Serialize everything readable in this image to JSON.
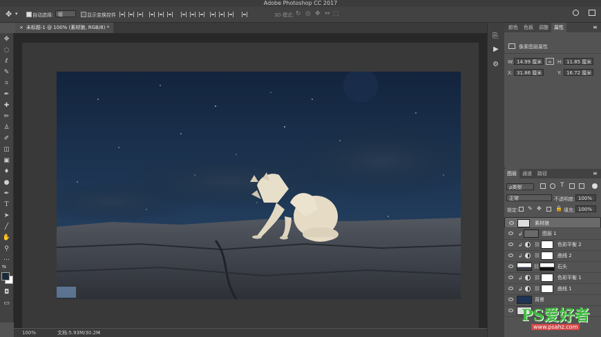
{
  "app": {
    "title": "Adobe Photoshop CC 2017"
  },
  "options": {
    "auto_select_label": "自动选择:",
    "auto_select_value": "组",
    "show_transform_label": "显示变换控件",
    "mode_label": "3D 模式:"
  },
  "document": {
    "tab_title": "未标题-1 @ 100% (素材狼, RGB/8) *"
  },
  "status": {
    "zoom": "100%",
    "doc_size": "文档:5.93M/30.2M"
  },
  "properties": {
    "tabs": [
      "颜色",
      "色板",
      "调整",
      "属性"
    ],
    "subtitle": "像素图层属性",
    "w_label": "W:",
    "w_value": "14.99 厘米",
    "h_label": "H:",
    "h_value": "11.85 厘米",
    "x_label": "X:",
    "x_value": "31.86 厘米",
    "y_label": "Y:",
    "y_value": "16.72 厘米"
  },
  "layers_panel": {
    "tabs": [
      "图层",
      "通道",
      "路径"
    ],
    "filter_label": "ρ类型",
    "blend_mode": "正常",
    "opacity_label": "不透明度:",
    "opacity_value": "100%",
    "lock_label": "锁定:",
    "fill_label": "填充:",
    "fill_value": "100%",
    "layers": [
      {
        "name": "素材狼",
        "type": "pixel",
        "selected": true
      },
      {
        "name": "图层 1",
        "type": "pixel",
        "clip": true
      },
      {
        "name": "色彩平衡 2",
        "type": "adjust",
        "clip": true
      },
      {
        "name": "曲线 2",
        "type": "adjust",
        "clip": true
      },
      {
        "name": "石头",
        "type": "pixel-mask"
      },
      {
        "name": "色彩平衡 1",
        "type": "adjust",
        "clip": true
      },
      {
        "name": "曲线 1",
        "type": "adjust",
        "clip": true
      },
      {
        "name": "背景",
        "type": "background"
      },
      {
        "name": "",
        "type": "pixel"
      }
    ]
  },
  "watermark": {
    "brand": "PS爱好者",
    "url": "www.psahz.com"
  },
  "colors": {
    "accent": "#2d6fd6",
    "sky_top": "#142742",
    "sky_bottom": "#2a4464",
    "rock": "#3e4249",
    "wolf": "#e8e0cc"
  }
}
